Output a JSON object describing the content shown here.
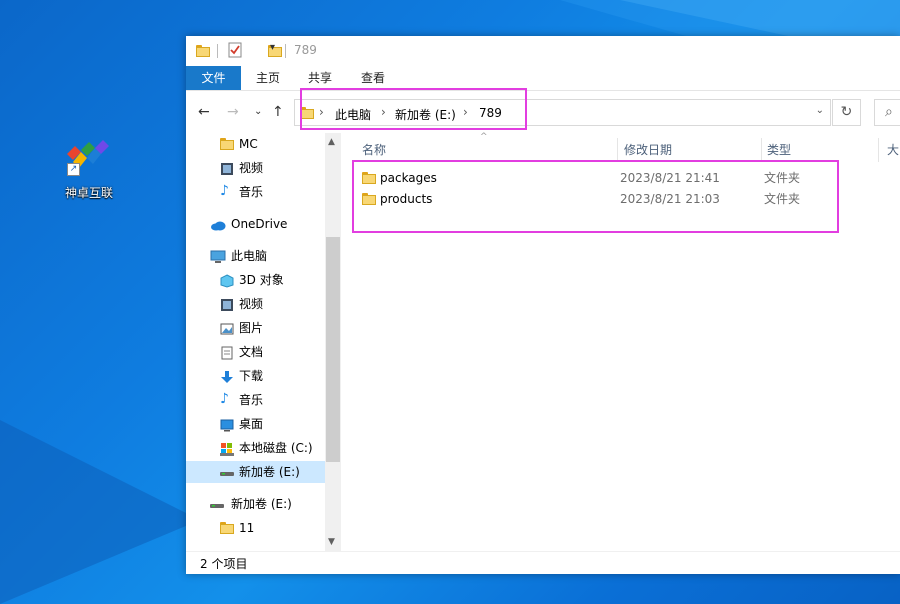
{
  "desktop": {
    "icons": [
      {
        "label": "神卓互联",
        "icon": "shenzhuo-logo-icon"
      }
    ]
  },
  "window": {
    "title": "789",
    "ribbon_tabs": [
      {
        "label": "文件",
        "active": true
      },
      {
        "label": "主页"
      },
      {
        "label": "共享"
      },
      {
        "label": "查看"
      }
    ],
    "address": {
      "crumbs": [
        "此电脑",
        "新加卷 (E:)",
        "789"
      ]
    },
    "nav_pane": [
      {
        "label": "MC",
        "icon": "folder-icon"
      },
      {
        "label": "视频",
        "icon": "video-icon"
      },
      {
        "label": "音乐",
        "icon": "music-icon"
      },
      {
        "label": "OneDrive",
        "icon": "onedrive-cloud-icon"
      },
      {
        "label": "此电脑",
        "icon": "this-pc-icon"
      },
      {
        "label": "3D 对象",
        "icon": "3d-objects-icon"
      },
      {
        "label": "视频",
        "icon": "video-icon"
      },
      {
        "label": "图片",
        "icon": "pictures-icon"
      },
      {
        "label": "文档",
        "icon": "documents-icon"
      },
      {
        "label": "下载",
        "icon": "download-icon"
      },
      {
        "label": "音乐",
        "icon": "music-icon"
      },
      {
        "label": "桌面",
        "icon": "desktop-icon"
      },
      {
        "label": "本地磁盘 (C:)",
        "icon": "drive-c-icon"
      },
      {
        "label": "新加卷 (E:)",
        "icon": "drive-icon",
        "selected": true
      },
      {
        "label": "新加卷 (E:)",
        "icon": "drive-icon"
      },
      {
        "label": "11",
        "icon": "folder-icon"
      }
    ],
    "columns": [
      "名称",
      "修改日期",
      "类型",
      "大"
    ],
    "files": [
      {
        "name": "packages",
        "date": "2023/8/21 21:41",
        "type": "文件夹"
      },
      {
        "name": "products",
        "date": "2023/8/21 21:03",
        "type": "文件夹"
      }
    ],
    "status": "2 个项目"
  },
  "colors": {
    "accent": "#1979ca",
    "highlight_box": "#e23ee0",
    "selection": "#cce8ff",
    "folder": "#f8d775"
  }
}
